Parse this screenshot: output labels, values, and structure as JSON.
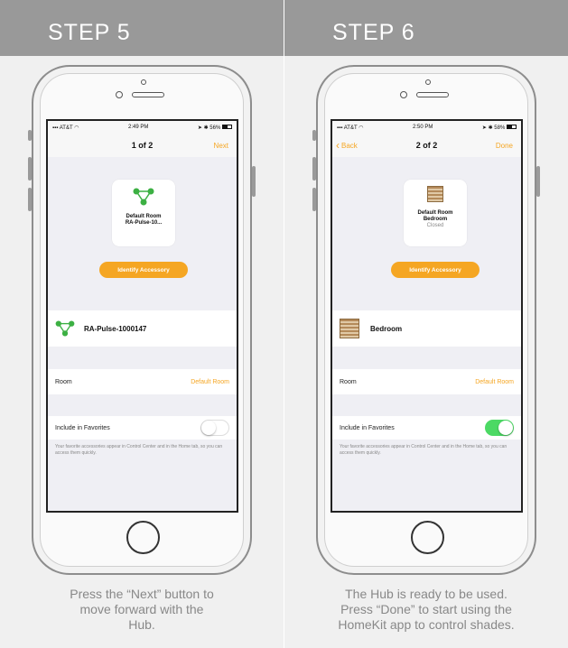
{
  "colors": {
    "accent": "#f5a623",
    "toggle_on": "#4cd964",
    "header_bg": "#999999"
  },
  "left": {
    "title": "STEP 5",
    "status": {
      "carrier": "AT&T",
      "time": "2:49 PM",
      "battery": "56%"
    },
    "nav": {
      "title": "1 of 2",
      "next": "Next"
    },
    "card": {
      "icon": "hub-network-icon",
      "line1": "Default Room",
      "line2": "RA-Pulse-10..."
    },
    "identify": "Identify Accessory",
    "accessory_name": "RA-Pulse-1000147",
    "room_label": "Room",
    "room_value": "Default Room",
    "favorites_label": "Include in Favorites",
    "favorites_on": false,
    "favorites_note": "Your favorite accessories appear in Control Center and in the Home tab, so you can access them quickly.",
    "caption": [
      "Press the “Next” button to",
      "move forward with the",
      "Hub."
    ]
  },
  "right": {
    "title": "STEP 6",
    "status": {
      "carrier": "AT&T",
      "time": "2:50 PM",
      "battery": "58%"
    },
    "nav": {
      "back": "Back",
      "title": "2 of 2",
      "done": "Done"
    },
    "card": {
      "icon": "window-shade-icon",
      "line1": "Default Room",
      "line2": "Bedroom",
      "line3": "Closed"
    },
    "identify": "Identify Accessory",
    "accessory_name": "Bedroom",
    "room_label": "Room",
    "room_value": "Default Room",
    "favorites_label": "Include in Favorites",
    "favorites_on": true,
    "favorites_note": "Your favorite accessories appear in Control Center and in the Home tab, so you can access them quickly.",
    "caption": [
      "The Hub is ready to be used.",
      "Press “Done” to start using the",
      "HomeKit app to control shades."
    ]
  }
}
